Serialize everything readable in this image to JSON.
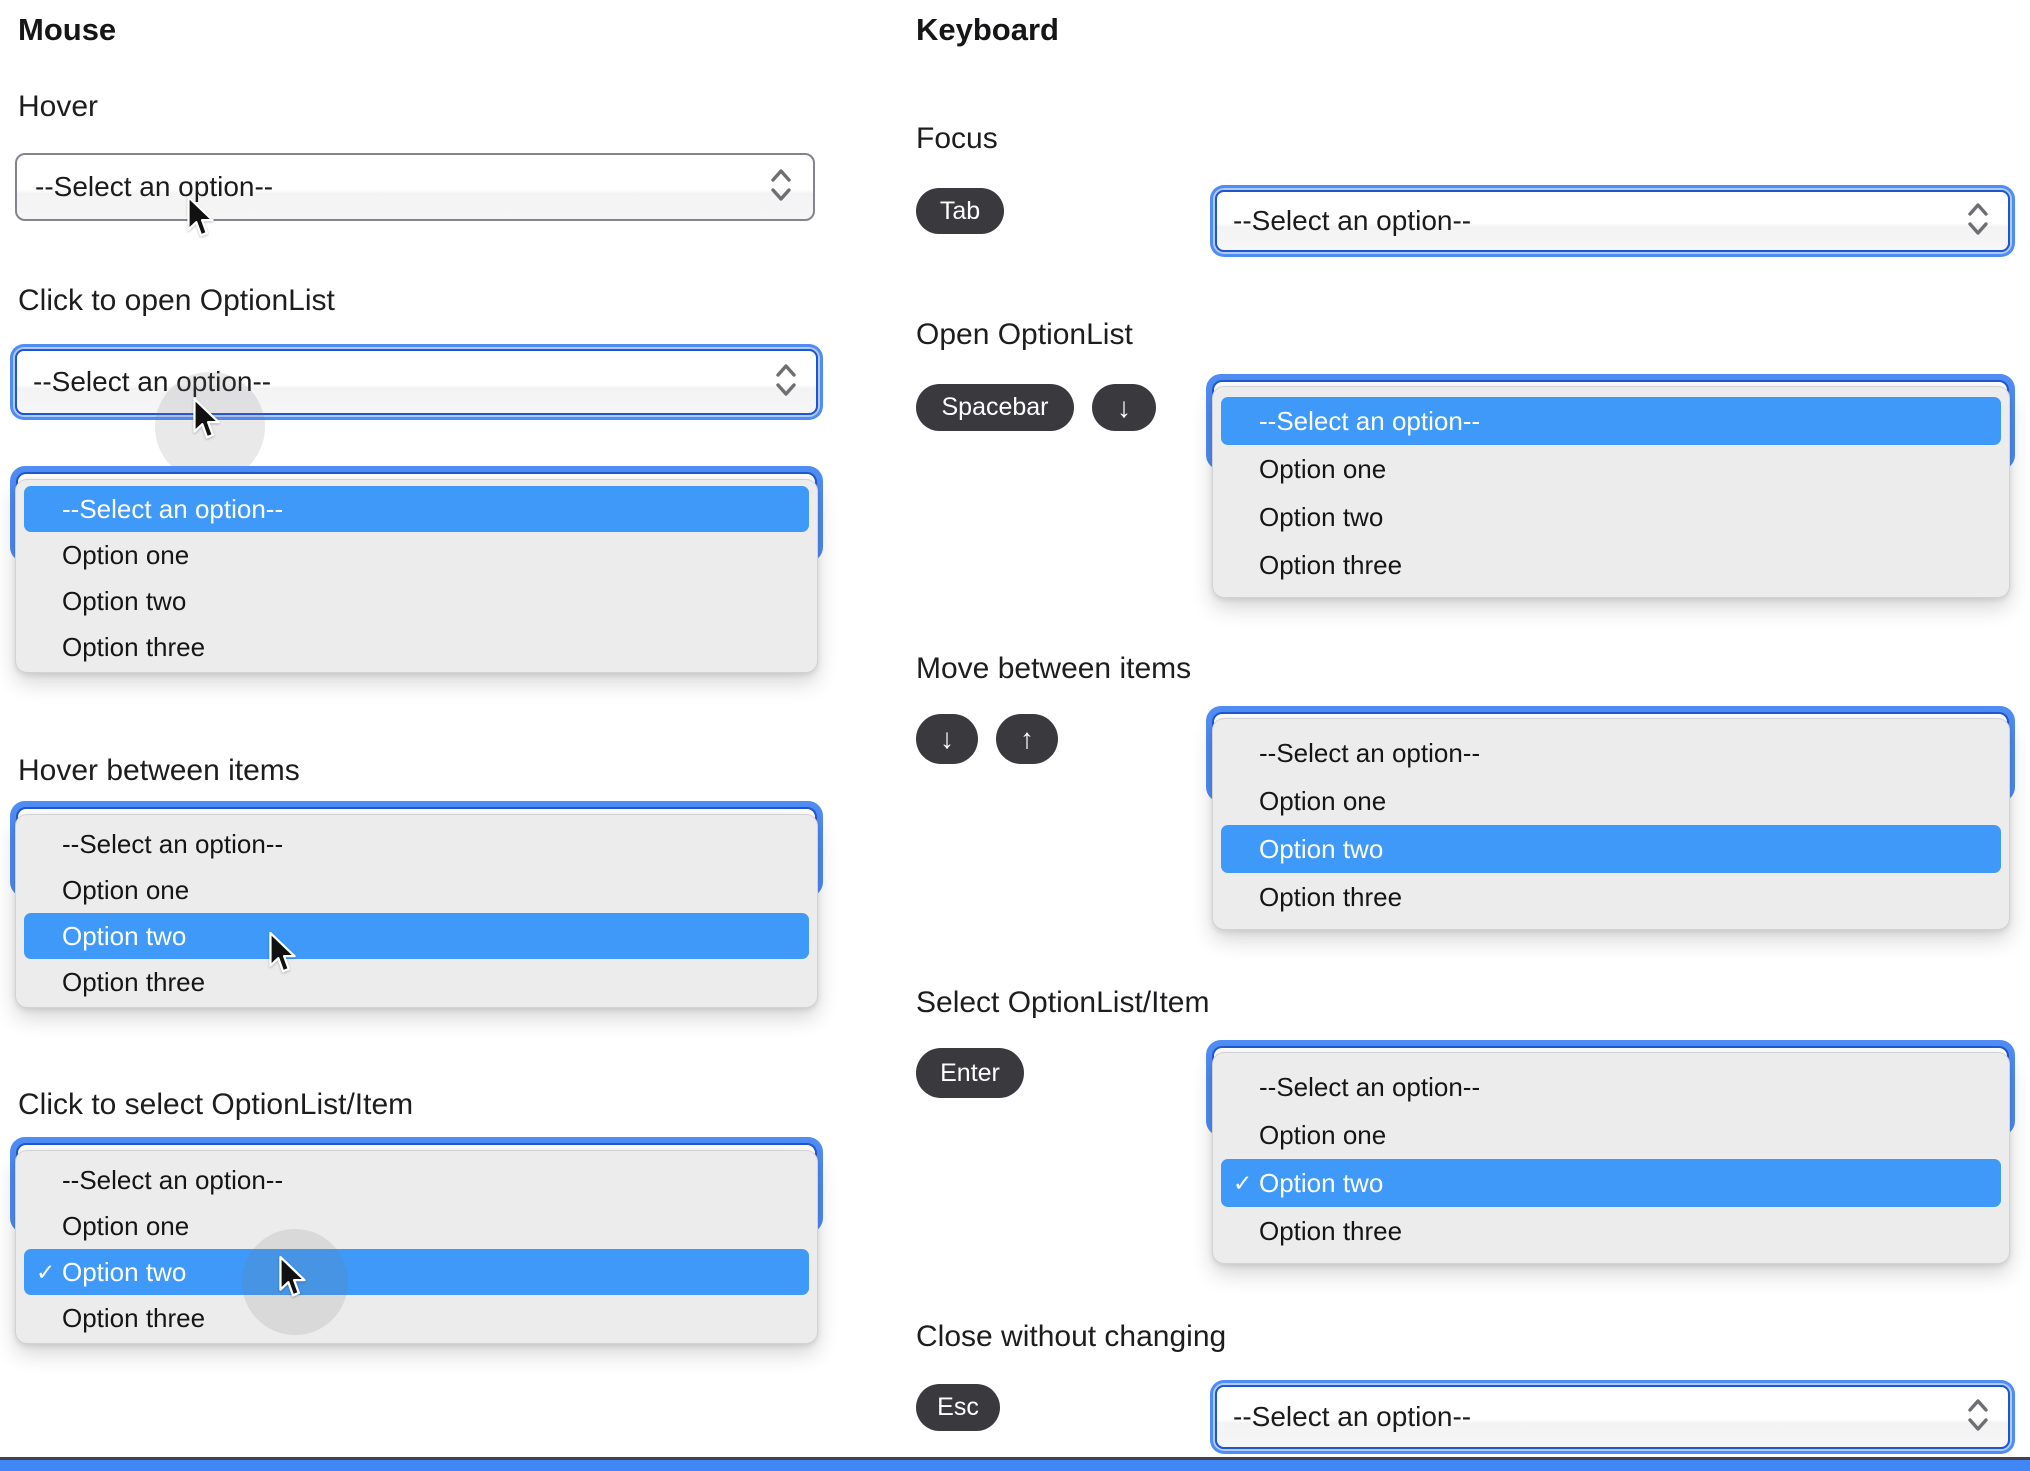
{
  "left": {
    "title": "Mouse",
    "sections": [
      {
        "label": "Hover"
      },
      {
        "label": "Click to open OptionList"
      },
      {
        "label": "Hover between items"
      },
      {
        "label": "Click to select OptionList/Item"
      }
    ]
  },
  "right": {
    "title": "Keyboard",
    "sections": [
      {
        "label": "Focus",
        "keys": [
          "Tab"
        ]
      },
      {
        "label": "Open OptionList",
        "keys": [
          "Spacebar",
          "↓"
        ]
      },
      {
        "label": "Move between items",
        "keys": [
          "↓",
          "↑"
        ]
      },
      {
        "label": "Select OptionList/Item",
        "keys": [
          "Enter"
        ]
      },
      {
        "label": "Close without changing",
        "keys": [
          "Esc"
        ]
      }
    ]
  },
  "select": {
    "placeholder": "--Select an option--",
    "options": [
      "--Select an option--",
      "Option one",
      "Option two",
      "Option three"
    ],
    "checkmark": "✓"
  },
  "colors": {
    "highlight_blue": "#3f99f8",
    "focus_halo_blue": "#4f8cf4",
    "focus_border_blue": "#1d56d0",
    "key_badge_bg": "#3a3a3e",
    "panel_bg": "#ececec",
    "select_border_gray": "#84848c",
    "bottom_bar_blue": "#4285f4"
  }
}
